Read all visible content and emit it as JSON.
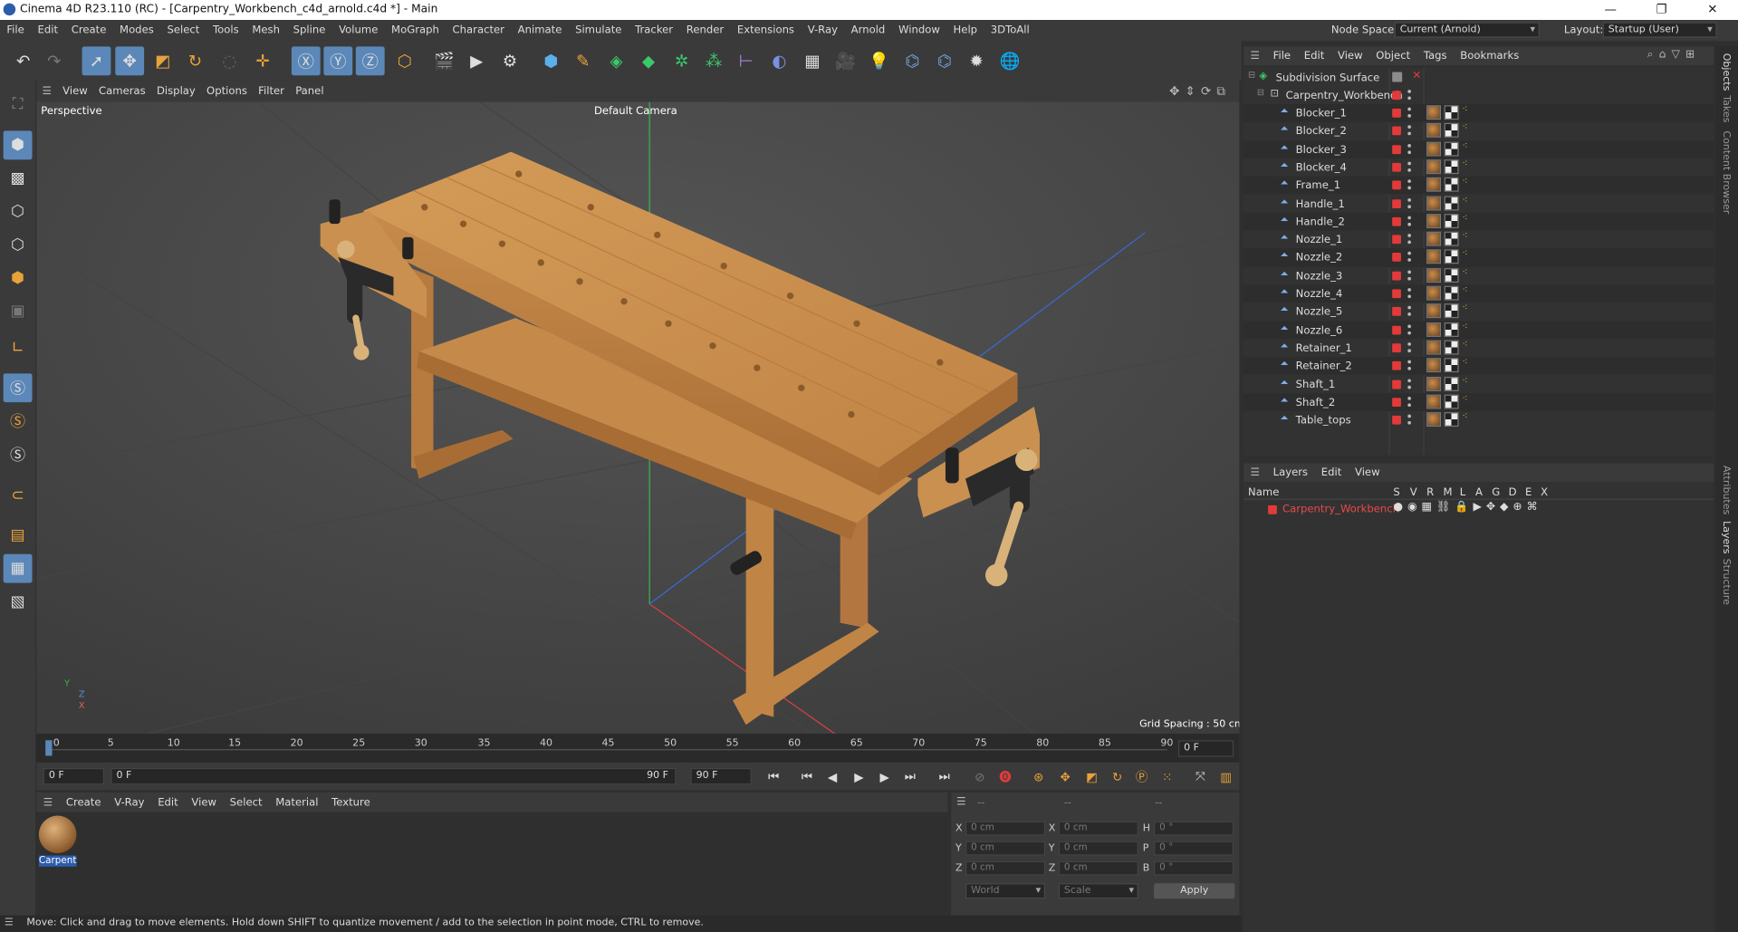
{
  "window": {
    "title": "Cinema 4D R23.110 (RC) - [Carpentry_Workbench_c4d_arnold.c4d *] - Main",
    "buttons": [
      "—",
      "❐",
      "✕"
    ]
  },
  "menus": [
    "File",
    "Edit",
    "Create",
    "Modes",
    "Select",
    "Tools",
    "Mesh",
    "Spline",
    "Volume",
    "MoGraph",
    "Character",
    "Animate",
    "Simulate",
    "Tracker",
    "Render",
    "Extensions",
    "V-Ray",
    "Arnold",
    "Window",
    "Help",
    "3DToAll"
  ],
  "node_space": {
    "label": "Node Space:",
    "value": "Current (Arnold)"
  },
  "layout": {
    "label": "Layout:",
    "value": "Startup (User)"
  },
  "viewport": {
    "menu": [
      "View",
      "Cameras",
      "Display",
      "Options",
      "Filter",
      "Panel"
    ],
    "perspective": "Perspective",
    "camera": "Default Camera",
    "grid_spacing": "Grid Spacing : 50 cm",
    "axis": {
      "y": "Y",
      "z": "Z",
      "x": "X"
    }
  },
  "timeline": {
    "ticks": [
      "0",
      "5",
      "10",
      "15",
      "20",
      "25",
      "30",
      "35",
      "40",
      "45",
      "50",
      "55",
      "60",
      "65",
      "70",
      "75",
      "80",
      "85",
      "90"
    ],
    "current": "0 F"
  },
  "transport": {
    "start": "0 F",
    "range_start": "0 F",
    "range_end": "90 F",
    "end": "90 F"
  },
  "material_manager": {
    "menu": [
      "Create",
      "V-Ray",
      "Edit",
      "View",
      "Select",
      "Material",
      "Texture"
    ],
    "material": "Carpentr"
  },
  "coordinates": {
    "headers": [
      "--",
      "--",
      "--"
    ],
    "rows": [
      [
        "X",
        "0 cm",
        "X",
        "0 cm",
        "H",
        "0 °"
      ],
      [
        "Y",
        "0 cm",
        "Y",
        "0 cm",
        "P",
        "0 °"
      ],
      [
        "Z",
        "0 cm",
        "Z",
        "0 cm",
        "B",
        "0 °"
      ]
    ],
    "world": "World",
    "scale": "Scale",
    "apply": "Apply"
  },
  "status": "Move: Click and drag to move elements. Hold down SHIFT to quantize movement / add to the selection in point mode, CTRL to remove.",
  "object_manager": {
    "menu": [
      "File",
      "Edit",
      "View",
      "Object",
      "Tags",
      "Bookmarks"
    ],
    "root": "Subdivision Surface",
    "group": "Carpentry_Workbench",
    "objects": [
      "Blocker_1",
      "Blocker_2",
      "Blocker_3",
      "Blocker_4",
      "Frame_1",
      "Handle_1",
      "Handle_2",
      "Nozzle_1",
      "Nozzle_2",
      "Nozzle_3",
      "Nozzle_4",
      "Nozzle_5",
      "Nozzle_6",
      "Retainer_1",
      "Retainer_2",
      "Shaft_1",
      "Shaft_2",
      "Table_tops"
    ]
  },
  "layers": {
    "menu": [
      "Layers",
      "Edit",
      "View"
    ],
    "name_header": "Name",
    "flags": [
      "S",
      "V",
      "R",
      "M",
      "L",
      "A",
      "G",
      "D",
      "E",
      "X"
    ],
    "layer": "Carpentry_Workbench",
    "layer_color": "#e23a3a"
  },
  "side_tabs": [
    "Objects",
    "Takes",
    "Content Browser",
    "Attributes",
    "Layers",
    "Structure"
  ],
  "colors": {
    "accent": "#5b88b8",
    "layer_red": "#e23a3a",
    "wood": "#c98d4c"
  }
}
